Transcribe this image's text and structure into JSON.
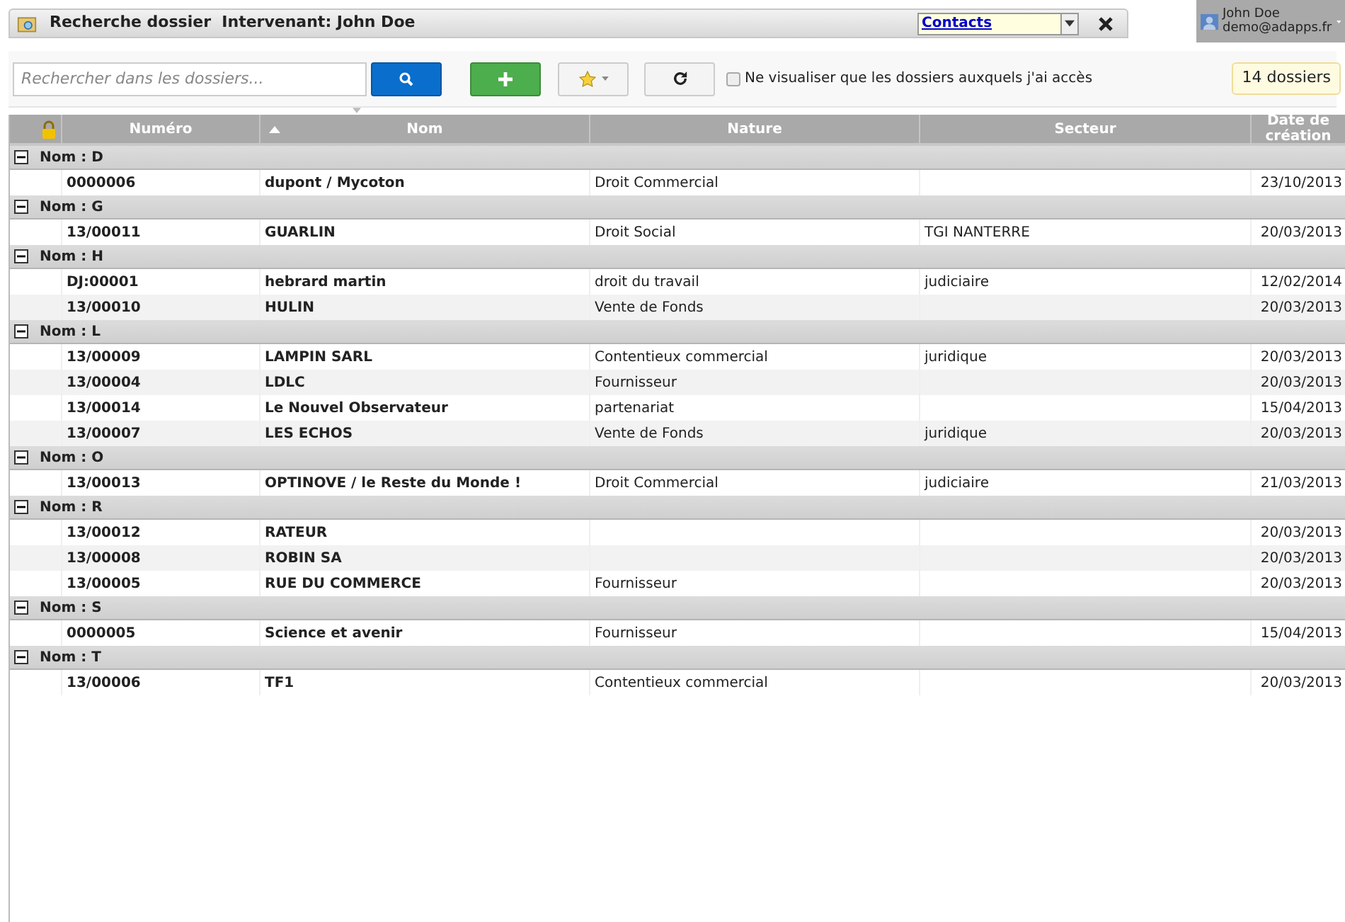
{
  "window": {
    "title": "Recherche dossier  Intervenant: John Doe"
  },
  "contacts_select": {
    "value": "Contacts"
  },
  "user": {
    "name": "John Doe",
    "email": "demo@adapps.fr"
  },
  "search": {
    "placeholder": "Rechercher dans les dossiers..."
  },
  "filter": {
    "label": "Ne visualiser que les dossiers auxquels j'ai accès",
    "checked": false
  },
  "count": "14 dossiers",
  "table": {
    "columns": [
      {
        "label": "Numéro",
        "sorted": false
      },
      {
        "label": "Nom",
        "sorted": true
      },
      {
        "label": "Nature",
        "sorted": false
      },
      {
        "label": "Secteur",
        "sorted": false
      },
      {
        "label": "Date de création",
        "sorted": false
      }
    ],
    "groups": [
      {
        "label": "Nom : D",
        "expanded": true,
        "rows": [
          [
            "0000006",
            "dupont / Mycoton",
            "Droit Commercial",
            "",
            "23/10/2013"
          ]
        ]
      },
      {
        "label": "Nom : G",
        "expanded": true,
        "rows": [
          [
            "13/00011",
            "GUARLIN",
            "Droit Social",
            "TGI NANTERRE",
            "20/03/2013"
          ]
        ]
      },
      {
        "label": "Nom : H",
        "expanded": true,
        "rows": [
          [
            "DJ:00001",
            "hebrard martin",
            "droit du travail",
            "judiciaire",
            "12/02/2014"
          ],
          [
            "13/00010",
            "HULIN",
            "Vente de Fonds",
            "",
            "20/03/2013"
          ]
        ]
      },
      {
        "label": "Nom : L",
        "expanded": true,
        "rows": [
          [
            "13/00009",
            "LAMPIN SARL",
            "Contentieux commercial",
            "juridique",
            "20/03/2013"
          ],
          [
            "13/00004",
            "LDLC",
            "Fournisseur",
            "",
            "20/03/2013"
          ],
          [
            "13/00014",
            "Le Nouvel Observateur",
            "partenariat",
            "",
            "15/04/2013"
          ],
          [
            "13/00007",
            "LES ECHOS",
            "Vente de Fonds",
            "juridique",
            "20/03/2013"
          ]
        ]
      },
      {
        "label": "Nom : O",
        "expanded": true,
        "rows": [
          [
            "13/00013",
            "OPTINOVE / le Reste du Monde !",
            "Droit Commercial",
            "judiciaire",
            "21/03/2013"
          ]
        ]
      },
      {
        "label": "Nom : R",
        "expanded": true,
        "rows": [
          [
            "13/00012",
            "RATEUR",
            "",
            "",
            "20/03/2013"
          ],
          [
            "13/00008",
            "ROBIN SA",
            "",
            "",
            "20/03/2013"
          ],
          [
            "13/00005",
            "RUE DU COMMERCE",
            "Fournisseur",
            "",
            "20/03/2013"
          ]
        ]
      },
      {
        "label": "Nom : S",
        "expanded": true,
        "rows": [
          [
            "0000005",
            "Science et avenir",
            "Fournisseur",
            "",
            "15/04/2013"
          ]
        ]
      },
      {
        "label": "Nom : T",
        "expanded": true,
        "rows": [
          [
            "13/00006",
            "TF1",
            "Contentieux commercial",
            "",
            "20/03/2013"
          ]
        ]
      }
    ]
  }
}
